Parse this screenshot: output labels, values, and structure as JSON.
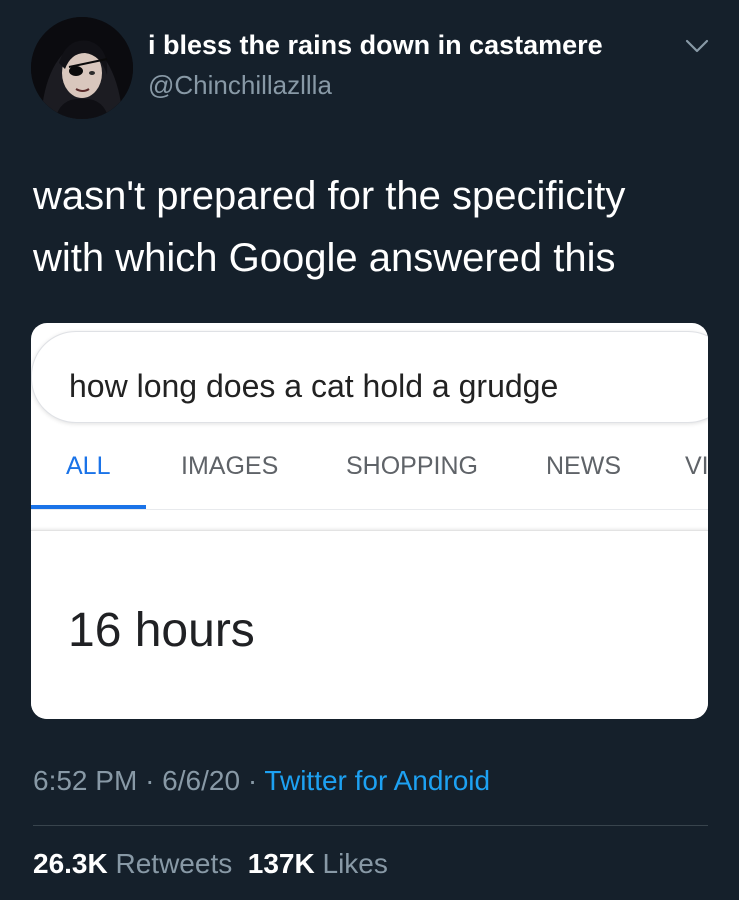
{
  "tweet": {
    "author": {
      "display_name": "i bless the rains down in castamere",
      "handle": "@Chinchillazllla"
    },
    "text_lines": [
      "wasn't prepared for the specificity",
      "with which Google answered this"
    ],
    "time": "6:52 PM",
    "date": "6/6/20",
    "separator": "·",
    "source": "Twitter for Android",
    "retweets_count": "26.3K",
    "retweets_label": "Retweets",
    "likes_count": "137K",
    "likes_label": "Likes",
    "icons": {
      "avatar": "avatar-photo",
      "menu": "chevron-down-icon"
    }
  },
  "google": {
    "query": "how long does a cat hold a grudge",
    "tabs": [
      {
        "label": "ALL",
        "active": true
      },
      {
        "label": "IMAGES",
        "active": false
      },
      {
        "label": "SHOPPING",
        "active": false
      },
      {
        "label": "NEWS",
        "active": false
      },
      {
        "label": "VI",
        "active": false
      }
    ],
    "answer": "16 hours"
  },
  "colors": {
    "background": "#15202b",
    "secondary_text": "#8899a6",
    "link": "#1da1f2",
    "google_active_tab": "#1a73e8"
  }
}
